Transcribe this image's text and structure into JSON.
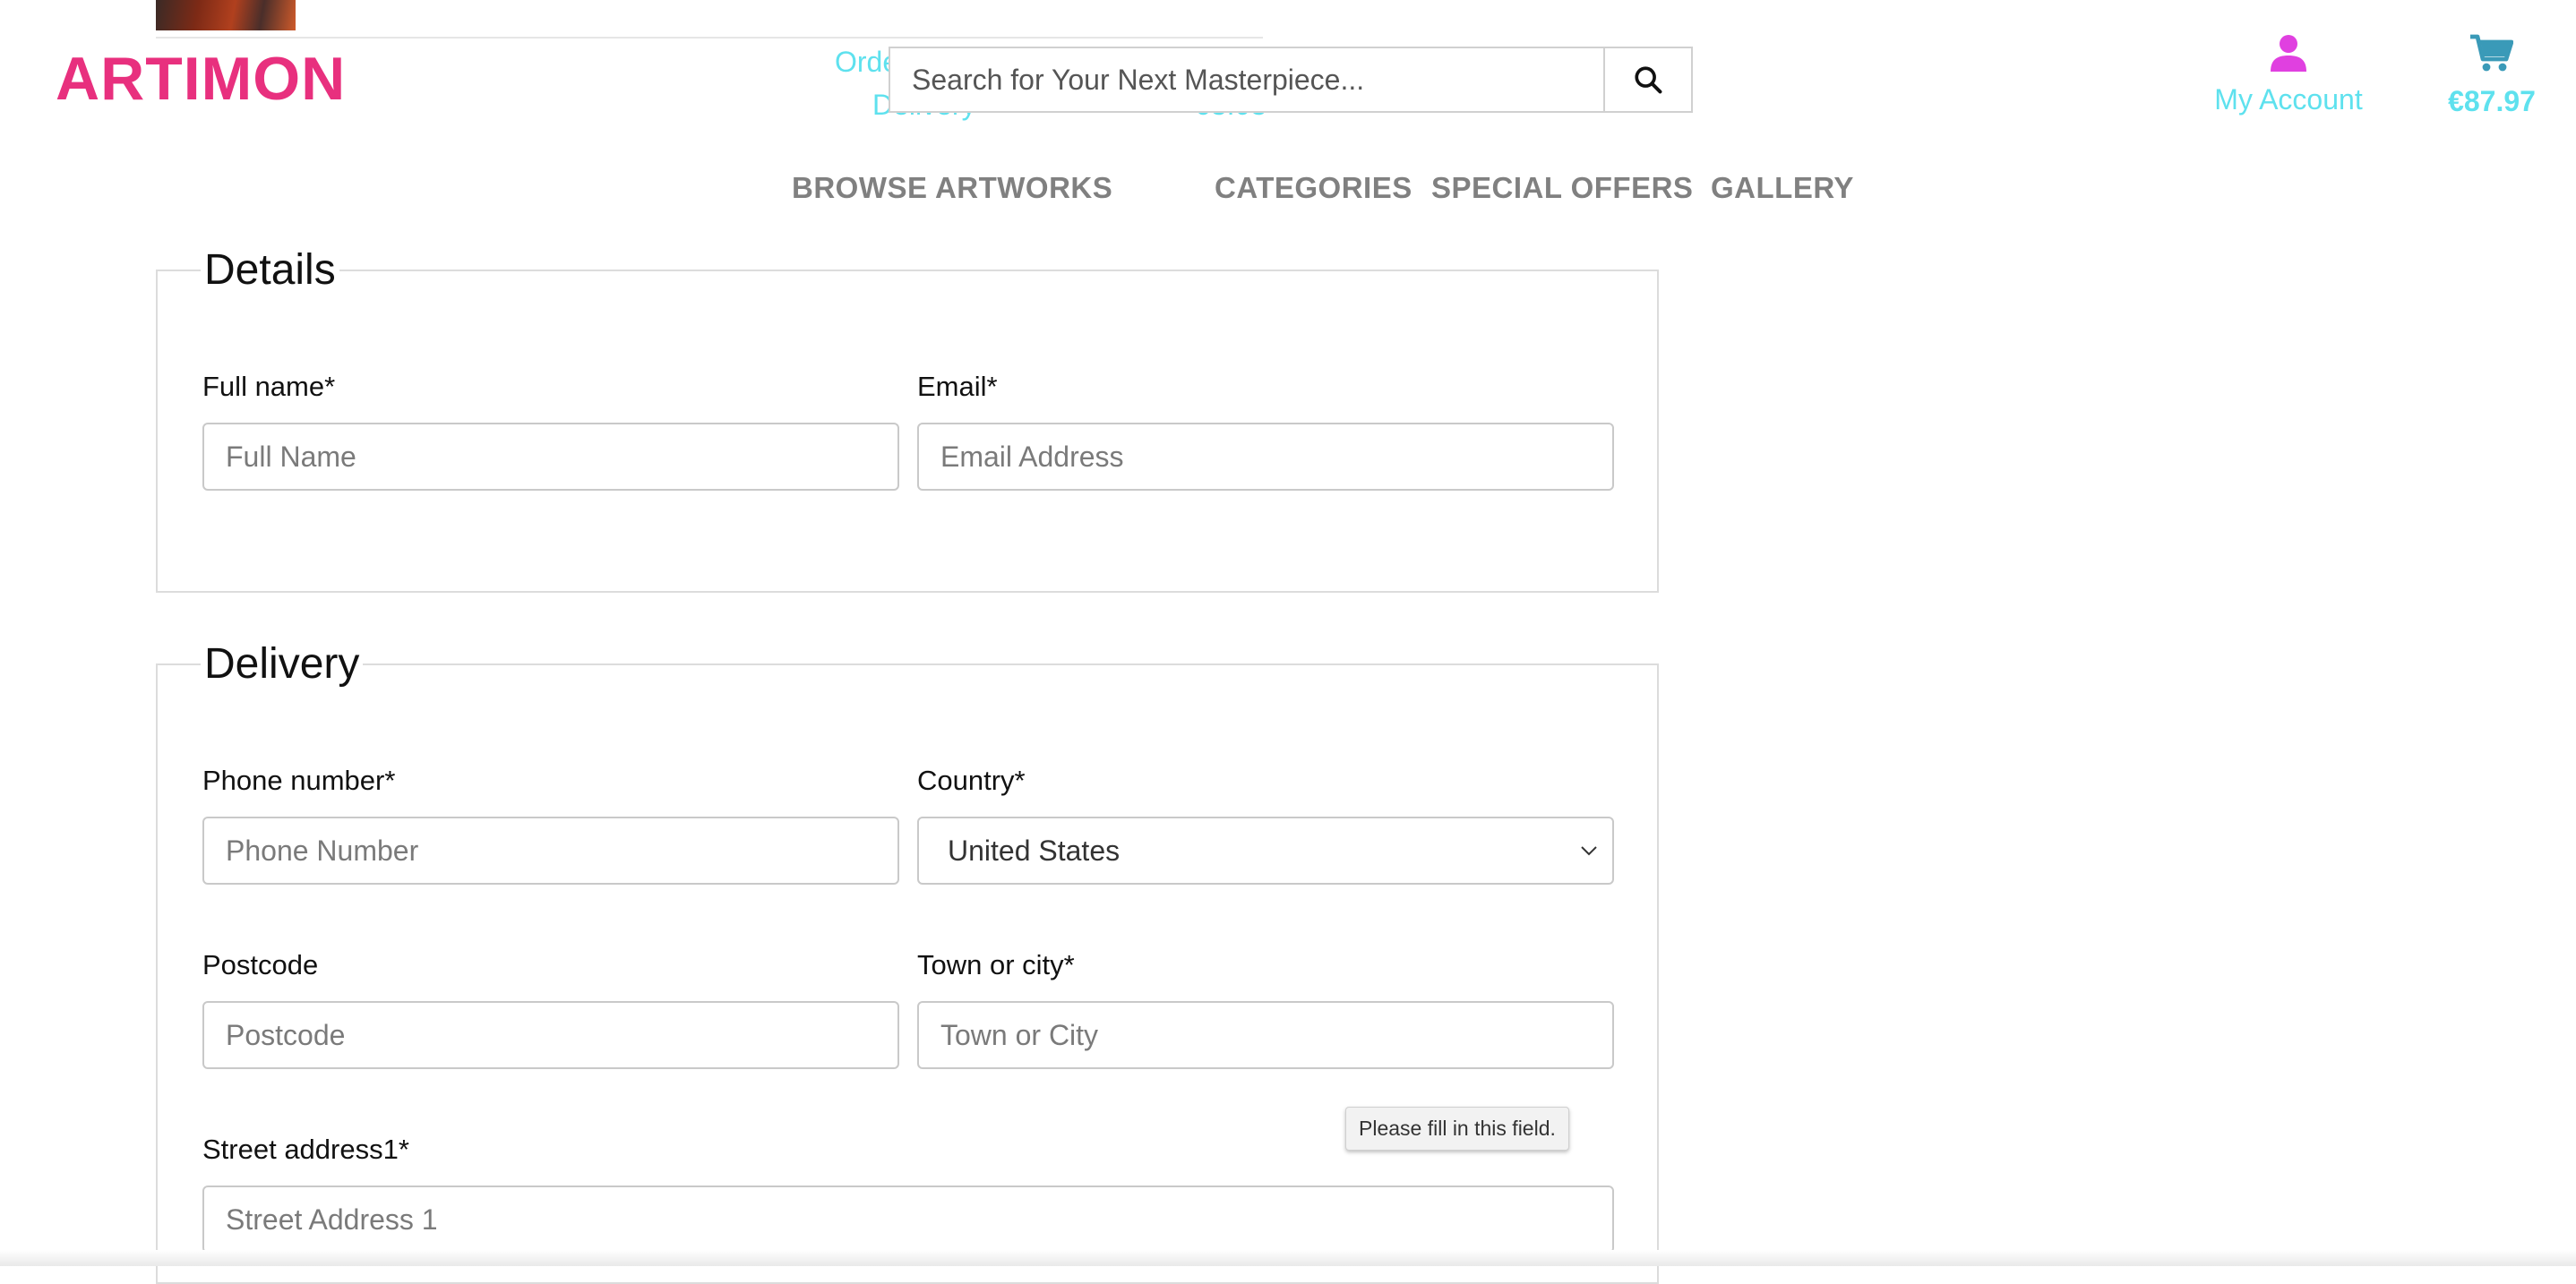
{
  "header": {
    "logo": "ARTIMON",
    "partial_left_line1": "Orde",
    "partial_left_line2": "Delivery",
    "partial_right": "63.03",
    "search_placeholder": "Search for Your Next Masterpiece...",
    "account_label": "My Account",
    "cart_total": "€87.97",
    "colors": {
      "logo": "#e8307e",
      "accent": "#5ee1ee",
      "account_icon": "#e040e0",
      "cart_icon": "#3a9ab8"
    }
  },
  "nav": {
    "items": [
      "BROWSE ARTWORKS",
      "CATEGORIES",
      "SPECIAL OFFERS",
      "GALLERY"
    ]
  },
  "details": {
    "legend": "Details",
    "full_name_label": "Full name*",
    "full_name_placeholder": "Full Name",
    "email_label": "Email*",
    "email_placeholder": "Email Address"
  },
  "delivery": {
    "legend": "Delivery",
    "phone_label": "Phone number*",
    "phone_placeholder": "Phone Number",
    "country_label": "Country*",
    "country_value": "United States",
    "postcode_label": "Postcode",
    "postcode_placeholder": "Postcode",
    "town_label": "Town or city*",
    "town_placeholder": "Town or City",
    "street1_label": "Street address1*",
    "street1_placeholder": "Street Address 1"
  },
  "tooltip": "Please fill in this field.",
  "icons": [
    "search-icon",
    "user-icon",
    "cart-icon",
    "chevron-down-icon"
  ]
}
